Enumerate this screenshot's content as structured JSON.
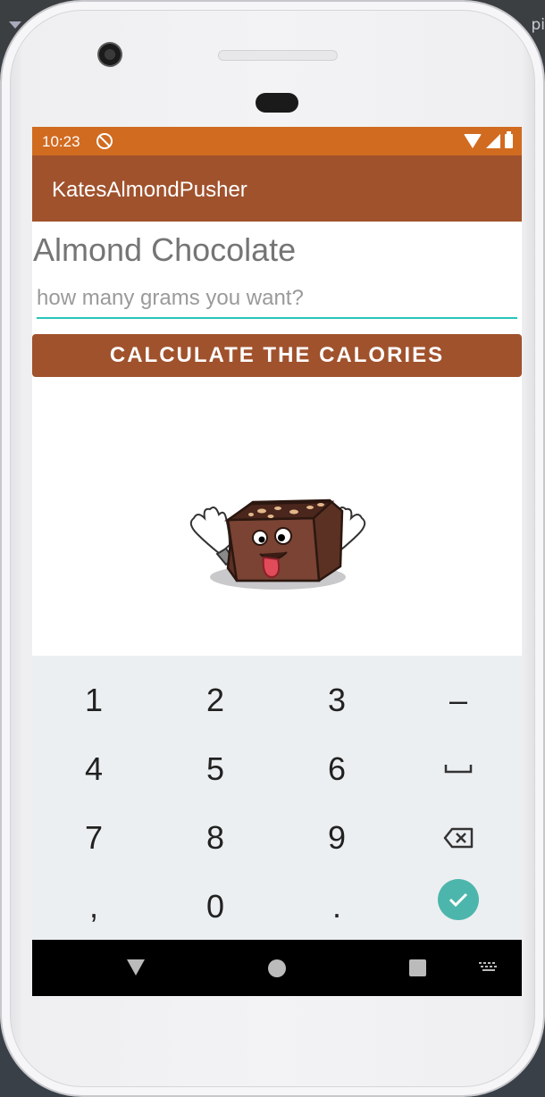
{
  "ide": {
    "corner_text": "pi"
  },
  "status": {
    "time": "10:23"
  },
  "app": {
    "title": "KatesAlmondPusher"
  },
  "main": {
    "heading": "Almond Chocolate",
    "grams_input": {
      "placeholder": "how many grams you want?",
      "value": ""
    },
    "calculate_button": "CALCULATE THE CALORIES",
    "illustration": "chocolate-almond-cake-mascot"
  },
  "keyboard": {
    "rows": [
      [
        "1",
        "2",
        "3",
        "–"
      ],
      [
        "4",
        "5",
        "6",
        "space-icon"
      ],
      [
        "7",
        "8",
        "9",
        "backspace-icon"
      ],
      [
        ",",
        "0",
        ".",
        "enter-check-icon"
      ]
    ],
    "keys": {
      "k1": "1",
      "k2": "2",
      "k3": "3",
      "kminus": "–",
      "k4": "4",
      "k5": "5",
      "k6": "6",
      "k7": "7",
      "k8": "8",
      "k9": "9",
      "kcomma": ",",
      "k0": "0",
      "kdot": "."
    }
  },
  "nav": {
    "icons": [
      "back-icon",
      "home-icon",
      "recents-icon",
      "keyboard-switch-icon"
    ]
  },
  "colors": {
    "status_bar": "#d16b20",
    "app_bar": "#a0522d",
    "accent": "#26c6b8",
    "enter_key": "#4db6ac",
    "keyboard_bg": "#eceff1"
  }
}
